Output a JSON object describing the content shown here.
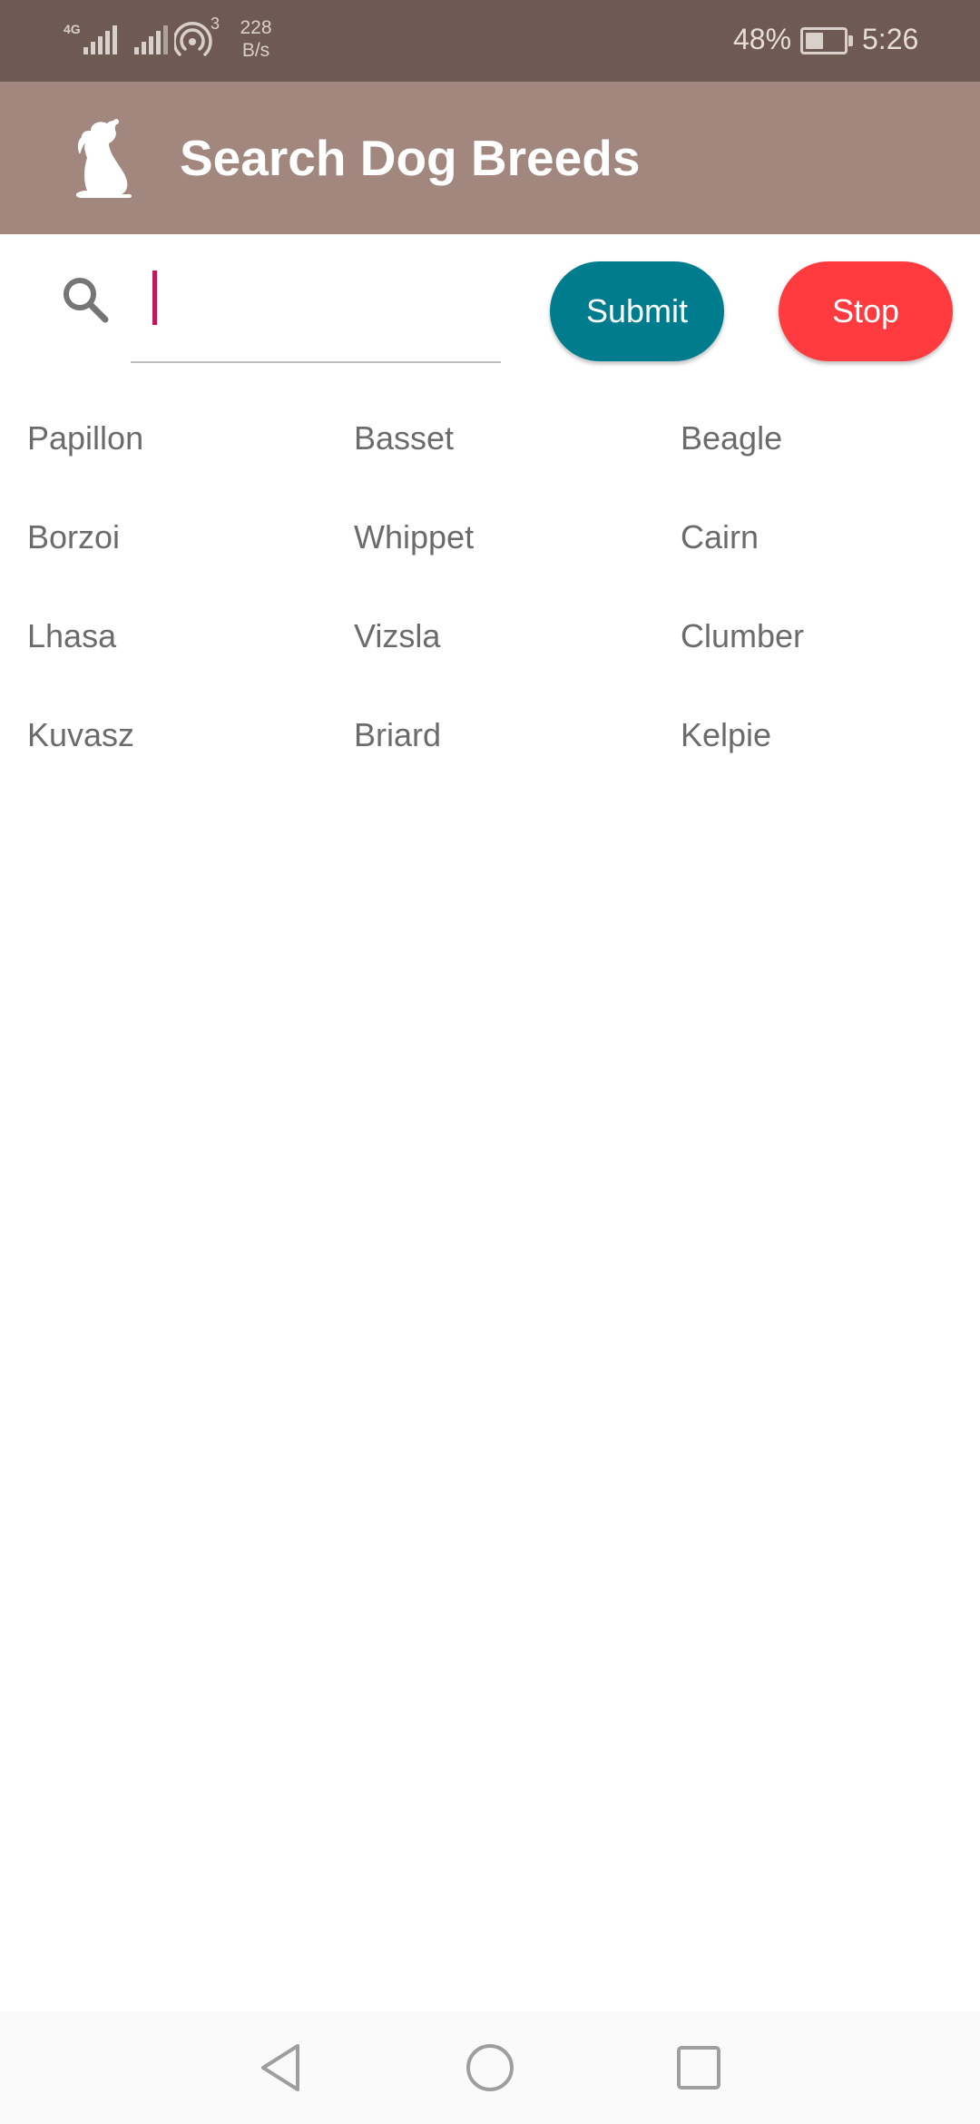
{
  "status_bar": {
    "network_type": "4G",
    "hotspot_count": "3",
    "speed_value": "228",
    "speed_unit": "B/s",
    "battery_percent": "48%",
    "battery_level": 0.48,
    "time": "5:26",
    "icons": [
      "signal-4g-icon",
      "signal-icon",
      "hotspot-icon",
      "battery-icon"
    ]
  },
  "app_bar": {
    "logo_icon": "dog-icon",
    "title": "Search Dog Breeds",
    "background_color": "#a1877d"
  },
  "search": {
    "icon": "search-icon",
    "value": "",
    "placeholder": ""
  },
  "buttons": {
    "submit_label": "Submit",
    "submit_color": "#007c8f",
    "stop_label": "Stop",
    "stop_color": "#ff3b3f"
  },
  "breeds": [
    "Papillon",
    "Basset",
    "Beagle",
    "Borzoi",
    "Whippet",
    "Cairn",
    "Lhasa",
    "Vizsla",
    "Clumber",
    "Kuvasz",
    "Briard",
    "Kelpie"
  ],
  "nav_bar": {
    "icons": [
      "back-icon",
      "home-icon",
      "recents-icon"
    ]
  }
}
